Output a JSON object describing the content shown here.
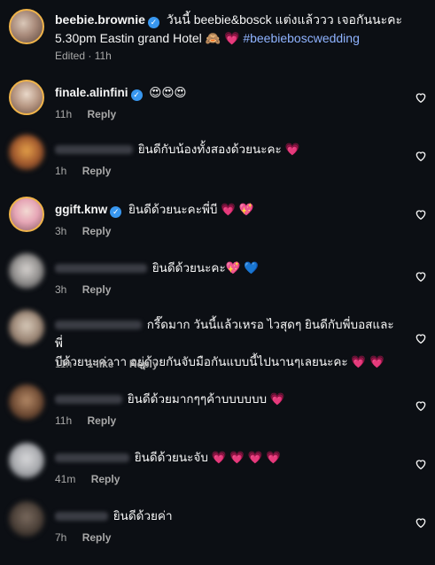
{
  "caption": {
    "username": "beebie.brownie",
    "text_line1": "วันนี้ beebie&bosck แต่งแล้ววว เจอกันนะคะ",
    "text_line2": "5.30pm Eastin grand Hotel 🙈 💗",
    "hashtag": "#beebieboscwedding",
    "edited": "Edited",
    "time": "11h"
  },
  "comments": [
    {
      "username": "finale.alinfini",
      "verified": true,
      "text": "😍😍😍",
      "time": "11h",
      "reply": "Reply"
    },
    {
      "username": "",
      "text": "ยินดีกับน้องทั้งสองด้วยนะคะ 💗",
      "time": "1h",
      "reply": "Reply"
    },
    {
      "username": "ggift.knw",
      "verified": true,
      "text": "ยินดีด้วยนะคะพี่บี 💗 💖",
      "time": "3h",
      "reply": "Reply"
    },
    {
      "username": "",
      "text": "ยินดีด้วยนะคะ💖 💙",
      "time": "3h",
      "reply": "Reply"
    },
    {
      "username": "",
      "text_line1": "กรี๊ดมาก วันนี้แล้วเหรอ ไวสุดๆ ยินดีกับพี่บอสและพี่",
      "text_line2": "บีด้วยนะค่าาา อยู่ด้วยกันจับมือกันแบบนี้ไปนานๆเลยนะคะ 💗 💗",
      "time": "11h",
      "likes": "1 like",
      "reply": "Reply"
    },
    {
      "username": "",
      "text": "ยินดีด้วยมากๆๆค้าบบบบบบ 💗",
      "time": "11h",
      "reply": "Reply"
    },
    {
      "username": "",
      "text": "ยินดีด้วยนะจับ 💗 💗 💗 💗",
      "time": "41m",
      "reply": "Reply"
    },
    {
      "username": "",
      "text": "ยินดีด้วยค่า",
      "time": "7h",
      "reply": "Reply"
    }
  ],
  "colors": {
    "background": "#0c0f14",
    "verified": "#3897f0",
    "hashtag": "#8fb3ff",
    "heart": "#ff3b6b"
  },
  "icons": {
    "verified": "verified-badge-icon",
    "like": "heart-outline-icon"
  }
}
